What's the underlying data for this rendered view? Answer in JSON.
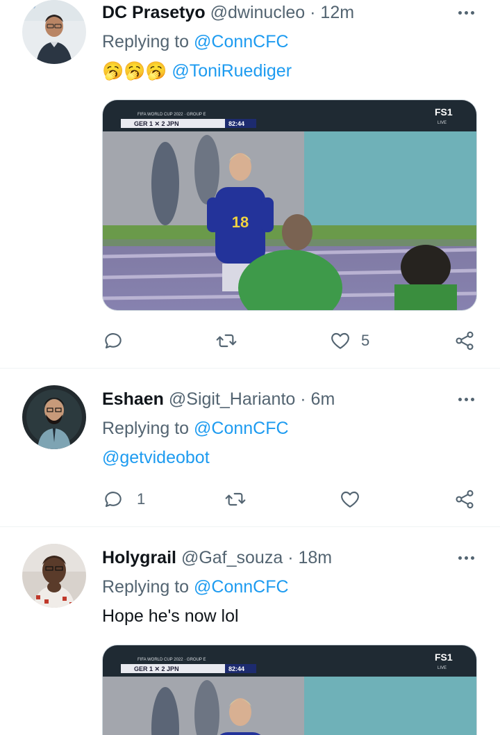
{
  "tweets": [
    {
      "name": "DC Prasetyo",
      "handle": "@dwinucleo",
      "time": "12m",
      "replying_prefix": "Replying to",
      "replying_to": "@ConnCFC",
      "emoji": "🥱🥱🥱",
      "text_mention": "@ToniRuediger",
      "reply_count": "",
      "retweet_count": "",
      "like_count": "5",
      "media": {
        "scoreboard": "GER 1 ✕ 2 JPN",
        "clock": "82:44",
        "competition": "FIFA WORLD CUP 2022 · GROUP E",
        "channel": "FS1",
        "live": "LIVE",
        "shirt_number": "18"
      }
    },
    {
      "name": "Eshaen",
      "handle": "@Sigit_Harianto",
      "time": "6m",
      "replying_prefix": "Replying to",
      "replying_to": "@ConnCFC",
      "text_mention": "@getvideobot",
      "reply_count": "1",
      "retweet_count": "",
      "like_count": ""
    },
    {
      "name": "Holygrail",
      "handle": "@Gaf_souza",
      "time": "18m",
      "replying_prefix": "Replying to",
      "replying_to": "@ConnCFC",
      "text": "Hope he's now lol",
      "media": {
        "scoreboard": "GER 1 ✕ 2 JPN",
        "clock": "82:44",
        "competition": "FIFA WORLD CUP 2022 · GROUP E",
        "channel": "FS1",
        "live": "LIVE"
      }
    }
  ],
  "colors": {
    "link": "#1d9bf0",
    "secondary": "#536471",
    "primary": "#0f1419",
    "divider": "#eff3f4"
  },
  "icons": [
    "reply-icon",
    "retweet-icon",
    "like-icon",
    "share-icon",
    "more-icon"
  ]
}
